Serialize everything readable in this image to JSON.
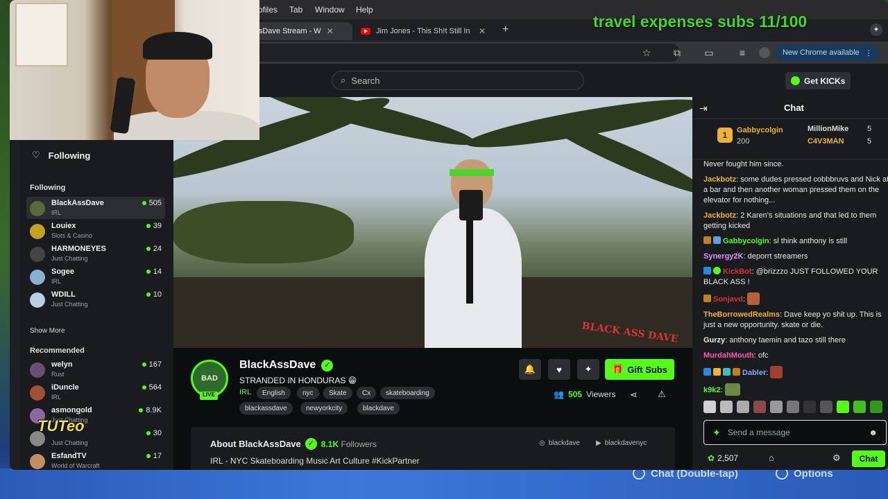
{
  "overlay": {
    "title": "travel expenses subs 11/100",
    "tuteo": "TUTeo",
    "bottom_btn_1": "Chat (Double-tap)",
    "bottom_btn_2": "Options"
  },
  "browser": {
    "menu": [
      "Profiles",
      "Tab",
      "Window",
      "Help"
    ],
    "tabs": [
      {
        "label": "AssDave Stream - W",
        "active": true
      },
      {
        "label": "Jim Jones - This Sh!t Still In",
        "active": false
      }
    ],
    "new_tab": "+",
    "chrome_available": "New Chrome available"
  },
  "kick": {
    "search_placeholder": "Search",
    "get_kicks": "Get KICKs"
  },
  "sidebar": {
    "following_title": "Following",
    "following_section": "Following",
    "following": [
      {
        "name": "BlackAssDave",
        "category": "IRL",
        "viewers": "505",
        "avatar": "#5a6b3a"
      },
      {
        "name": "Louiex",
        "category": "Slots & Casino",
        "viewers": "39",
        "avatar": "#c8a020"
      },
      {
        "name": "HARMONEYES",
        "category": "Just Chatting",
        "viewers": "24",
        "avatar": "#444"
      },
      {
        "name": "Sogee",
        "category": "IRL",
        "viewers": "14",
        "avatar": "#8ab0d0"
      },
      {
        "name": "WDILL",
        "category": "Just Chatting",
        "viewers": "10",
        "avatar": "#b8d0e0"
      }
    ],
    "show_more": "Show More",
    "recommended_section": "Recommended",
    "recommended": [
      {
        "name": "welyn",
        "category": "Rust",
        "viewers": "167",
        "avatar": "#6a5070"
      },
      {
        "name": "iDuncle",
        "category": "IRL",
        "viewers": "564",
        "avatar": "#a05030"
      },
      {
        "name": "asmongold",
        "category": "Just Chatting",
        "viewers": "8.9K",
        "avatar": "#8a6a9a"
      },
      {
        "name": "",
        "category": "Just Chatting",
        "viewers": "30",
        "avatar": "#888"
      },
      {
        "name": "EsfandTV",
        "category": "World of Warcraft",
        "viewers": "17",
        "avatar": "#c09060"
      }
    ]
  },
  "stream": {
    "channel": "BlackAssDave",
    "pfp_text": "BAD",
    "live": "LIVE",
    "title": "STRANDED IN HONDURAS 😁",
    "category": "IRL",
    "tags_row1": [
      "English",
      "nyc",
      "Skate",
      "Cx",
      "skateboarding"
    ],
    "tags_row2": [
      "blackassdave",
      "newyorkcity",
      "blackdave"
    ],
    "gift_subs": "Gift Subs",
    "viewers": "505",
    "viewers_label": "Viewers",
    "watermark": "BLACK ASS DAVE",
    "about_title": "About BlackAssDave",
    "followers": "8.1K",
    "followers_label": "Followers",
    "about_desc": "IRL - NYC Skateboarding Music Art Culture #KickPartner",
    "social_1": "blackdave",
    "social_2": "blackdavenyc"
  },
  "chat": {
    "title": "Chat",
    "leaderboard": {
      "top_rank": "1",
      "top_user": "Gabbycolgin",
      "top_count": "200",
      "second_user": "MillionMike",
      "second_count": "5",
      "third_user": "C4V3MAN",
      "third_count": "5"
    },
    "messages": [
      {
        "user": "",
        "color": "#e8e8e8",
        "text": "Never fought him since."
      },
      {
        "user": "Jackbotz",
        "color": "#f0b232",
        "text": "some dudes pressed cobbbruvs and Nick at a bar and then another woman pressed them on the elevator for nothing..."
      },
      {
        "user": "Jackbotz",
        "color": "#f0b232",
        "text": "2 Karen's situations and that led to them getting kicked"
      },
      {
        "user": "Gabbycolgin",
        "color": "#53fc18",
        "text": "sl think anthony is still"
      },
      {
        "user": "Synergy2K",
        "color": "#e88aff",
        "text": "deporrt streamers"
      },
      {
        "user": "KickBot",
        "color": "#e03030",
        "text": "@brizzzo JUST FOLLOWED YOUR BLACK ASS !"
      },
      {
        "user": "Sonjavd",
        "color": "#e03030",
        "text": ""
      },
      {
        "user": "TheBorrowedRealms",
        "color": "#f0b232",
        "text": "Dave keep yo shit up. This is just a new opportunity. skate or die."
      },
      {
        "user": "Gurzy",
        "color": "#e8e8e8",
        "text": "anthony taemin and tazo still there"
      },
      {
        "user": "MurdahMouth",
        "color": "#ff5ab4",
        "text": "ofc"
      },
      {
        "user": "Dabler",
        "color": "#7aa8ff",
        "text": ""
      },
      {
        "user": "k9k2",
        "color": "#53fc18",
        "text": ""
      }
    ],
    "input_placeholder": "Send a message",
    "kicks_count": "2,507",
    "send_label": "Chat"
  }
}
